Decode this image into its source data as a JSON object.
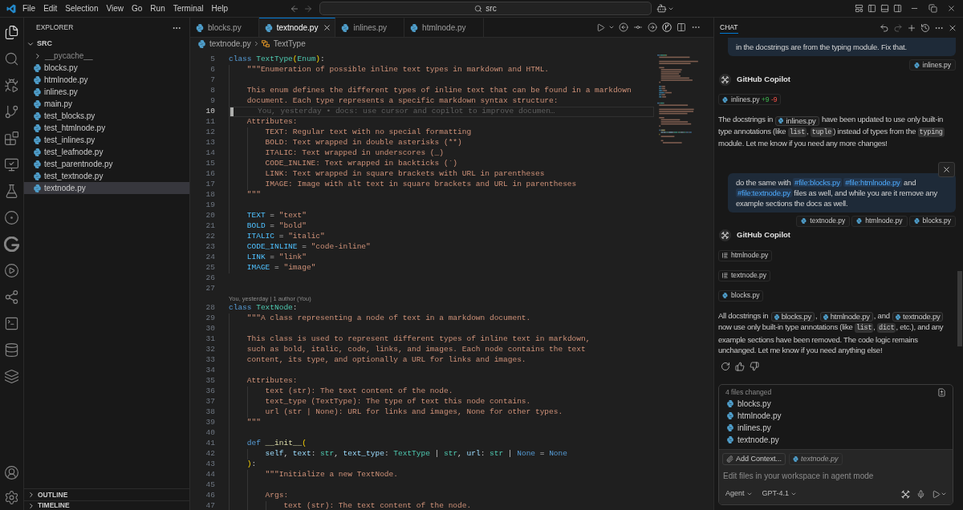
{
  "title_bar": {
    "menus": [
      "File",
      "Edit",
      "Selection",
      "View",
      "Go",
      "Run",
      "Terminal",
      "Help"
    ],
    "search": "src"
  },
  "activity_bar": [
    {
      "selected": true
    },
    {
      "selected": false
    },
    {
      "selected": false
    },
    {
      "selected": false
    },
    {
      "selected": false
    },
    {
      "selected": false
    },
    {
      "selected": false
    },
    {
      "selected": false
    },
    {
      "selected": false
    },
    {
      "selected": false
    },
    {
      "selected": false
    },
    {
      "selected": false
    },
    {
      "selected": false
    },
    {
      "selected": false
    }
  ],
  "sidebar": {
    "title": "EXPLORER",
    "folder": {
      "label": "SRC",
      "expanded": true,
      "items": [
        {
          "label": "__pycache__",
          "kind": "folder",
          "expanded": false,
          "ignored": true,
          "selected": false
        },
        {
          "label": "blocks.py",
          "kind": "file",
          "ignored": false,
          "selected": false
        },
        {
          "label": "htmlnode.py",
          "kind": "file",
          "ignored": false,
          "selected": false
        },
        {
          "label": "inlines.py",
          "kind": "file",
          "ignored": false,
          "selected": false
        },
        {
          "label": "main.py",
          "kind": "file",
          "ignored": false,
          "selected": false
        },
        {
          "label": "test_blocks.py",
          "kind": "file",
          "ignored": false,
          "selected": false
        },
        {
          "label": "test_htmlnode.py",
          "kind": "file",
          "ignored": false,
          "selected": false
        },
        {
          "label": "test_inlines.py",
          "kind": "file",
          "ignored": false,
          "selected": false
        },
        {
          "label": "test_leafnode.py",
          "kind": "file",
          "ignored": false,
          "selected": false
        },
        {
          "label": "test_parentnode.py",
          "kind": "file",
          "ignored": false,
          "selected": false
        },
        {
          "label": "test_textnode.py",
          "kind": "file",
          "ignored": false,
          "selected": false
        },
        {
          "label": "textnode.py",
          "kind": "file",
          "ignored": false,
          "selected": true
        }
      ]
    },
    "sections": [
      {
        "label": "OUTLINE",
        "expanded": false
      },
      {
        "label": "TIMELINE",
        "expanded": false
      }
    ]
  },
  "editor": {
    "tabs": [
      {
        "label": "blocks.py",
        "selected": false
      },
      {
        "label": "textnode.py",
        "selected": true
      },
      {
        "label": "inlines.py",
        "selected": false
      },
      {
        "label": "htmlnode.py",
        "selected": false
      }
    ],
    "breadcrumb": [
      {
        "kind": "file",
        "label": "textnode.py"
      },
      {
        "kind": "class",
        "label": "TextType"
      }
    ],
    "lines": [
      {
        "number": "5",
        "active": false,
        "tokens": [
          {
            "kind": "keyword",
            "text": "class"
          },
          {
            "kind": "type",
            "text": " TextType"
          },
          {
            "kind": "bracket",
            "text": "("
          },
          {
            "kind": "type",
            "text": "Enum"
          },
          {
            "kind": "bracket",
            "text": ")"
          },
          {
            "kind": "plain",
            "text": ":"
          }
        ]
      },
      {
        "number": "6",
        "active": false,
        "tokens": [
          {
            "kind": "string",
            "text": "    \"\"\"Enumeration of possible inline text types in markdown and HTML."
          }
        ]
      },
      {
        "number": "7",
        "active": false
      },
      {
        "number": "8",
        "active": false,
        "tokens": [
          {
            "kind": "string",
            "text": "    This enum defines the different types of inline text that can be found in a markdown"
          }
        ]
      },
      {
        "number": "9",
        "active": false,
        "tokens": [
          {
            "kind": "string",
            "text": "    document. Each type represents a specific markdown syntax structure:"
          }
        ]
      },
      {
        "number": "10",
        "active": true,
        "blame": "You, yesterday • docs: use cursor and copilot to improve documen…"
      },
      {
        "number": "11",
        "active": false,
        "tokens": [
          {
            "kind": "string",
            "text": "    Attributes:"
          }
        ]
      },
      {
        "number": "12",
        "active": false,
        "tokens": [
          {
            "kind": "string",
            "text": "        TEXT: Regular text with no special formatting"
          }
        ]
      },
      {
        "number": "13",
        "active": false,
        "tokens": [
          {
            "kind": "string",
            "text": "        BOLD: Text wrapped in double asterisks (**)"
          }
        ]
      },
      {
        "number": "14",
        "active": false,
        "tokens": [
          {
            "kind": "string",
            "text": "        ITALIC: Text wrapped in underscores (_)"
          }
        ]
      },
      {
        "number": "15",
        "active": false,
        "tokens": [
          {
            "kind": "string",
            "text": "        CODE_INLINE: Text wrapped in backticks (`)"
          }
        ]
      },
      {
        "number": "16",
        "active": false,
        "tokens": [
          {
            "kind": "string",
            "text": "        LINK: Text wrapped in square brackets with URL in parentheses"
          }
        ]
      },
      {
        "number": "17",
        "active": false,
        "tokens": [
          {
            "kind": "string",
            "text": "        IMAGE: Image with alt text in square brackets and URL in parentheses"
          }
        ]
      },
      {
        "number": "18",
        "active": false,
        "tokens": [
          {
            "kind": "string",
            "text": "    \"\"\""
          }
        ]
      },
      {
        "number": "19",
        "active": false
      },
      {
        "number": "20",
        "active": false,
        "tokens": [
          {
            "kind": "constant",
            "text": "    TEXT"
          },
          {
            "kind": "plain",
            "text": " = "
          },
          {
            "kind": "string",
            "text": "\"text\""
          }
        ]
      },
      {
        "number": "21",
        "active": false,
        "tokens": [
          {
            "kind": "constant",
            "text": "    BOLD"
          },
          {
            "kind": "plain",
            "text": " = "
          },
          {
            "kind": "string",
            "text": "\"bold\""
          }
        ]
      },
      {
        "number": "22",
        "active": false,
        "tokens": [
          {
            "kind": "constant",
            "text": "    ITALIC"
          },
          {
            "kind": "plain",
            "text": " = "
          },
          {
            "kind": "string",
            "text": "\"italic\""
          }
        ]
      },
      {
        "number": "23",
        "active": false,
        "tokens": [
          {
            "kind": "constant",
            "text": "    CODE_INLINE"
          },
          {
            "kind": "plain",
            "text": " = "
          },
          {
            "kind": "string",
            "text": "\"code-inline\""
          }
        ]
      },
      {
        "number": "24",
        "active": false,
        "tokens": [
          {
            "kind": "constant",
            "text": "    LINK"
          },
          {
            "kind": "plain",
            "text": " = "
          },
          {
            "kind": "string",
            "text": "\"link\""
          }
        ]
      },
      {
        "number": "25",
        "active": false,
        "tokens": [
          {
            "kind": "constant",
            "text": "    IMAGE"
          },
          {
            "kind": "plain",
            "text": " = "
          },
          {
            "kind": "string",
            "text": "\"image\""
          }
        ]
      },
      {
        "number": "26",
        "active": false
      },
      {
        "number": "27",
        "active": false
      },
      {
        "number": "28",
        "active": false,
        "codelens": "You, yesterday | 1 author (You)",
        "tokens": [
          {
            "kind": "keyword",
            "text": "class"
          },
          {
            "kind": "type",
            "text": " TextNode"
          },
          {
            "kind": "plain",
            "text": ":"
          }
        ]
      },
      {
        "number": "29",
        "active": false,
        "tokens": [
          {
            "kind": "string",
            "text": "    \"\"\"A class representing a node of text in a markdown document."
          }
        ]
      },
      {
        "number": "30",
        "active": false
      },
      {
        "number": "31",
        "active": false,
        "tokens": [
          {
            "kind": "string",
            "text": "    This class is used to represent different types of inline text in markdown,"
          }
        ]
      },
      {
        "number": "32",
        "active": false,
        "tokens": [
          {
            "kind": "string",
            "text": "    such as bold, italic, code, links, and images. Each node contains the text"
          }
        ]
      },
      {
        "number": "33",
        "active": false,
        "tokens": [
          {
            "kind": "string",
            "text": "    content, its type, and optionally a URL for links and images."
          }
        ]
      },
      {
        "number": "34",
        "active": false
      },
      {
        "number": "35",
        "active": false,
        "tokens": [
          {
            "kind": "string",
            "text": "    Attributes:"
          }
        ]
      },
      {
        "number": "36",
        "active": false,
        "tokens": [
          {
            "kind": "string",
            "text": "        text (str): The text content of the node."
          }
        ]
      },
      {
        "number": "37",
        "active": false,
        "tokens": [
          {
            "kind": "string",
            "text": "        text_type (TextType): The type of text this node contains."
          }
        ]
      },
      {
        "number": "38",
        "active": false,
        "tokens": [
          {
            "kind": "string",
            "text": "        url (str | None): URL for links and images, None for other types."
          }
        ]
      },
      {
        "number": "39",
        "active": false,
        "tokens": [
          {
            "kind": "string",
            "text": "    \"\"\""
          }
        ]
      },
      {
        "number": "40",
        "active": false
      },
      {
        "number": "41",
        "active": false,
        "tokens": [
          {
            "kind": "keyword",
            "text": "    def"
          },
          {
            "kind": "function",
            "text": " __init__"
          },
          {
            "kind": "bracket",
            "text": "("
          }
        ]
      },
      {
        "number": "42",
        "active": false,
        "tokens": [
          {
            "kind": "param",
            "text": "        self"
          },
          {
            "kind": "plain",
            "text": ", "
          },
          {
            "kind": "param",
            "text": "text"
          },
          {
            "kind": "plain",
            "text": ": "
          },
          {
            "kind": "type",
            "text": "str"
          },
          {
            "kind": "plain",
            "text": ", "
          },
          {
            "kind": "param",
            "text": "text_type"
          },
          {
            "kind": "plain",
            "text": ": "
          },
          {
            "kind": "type",
            "text": "TextType"
          },
          {
            "kind": "plain",
            "text": " | "
          },
          {
            "kind": "type",
            "text": "str"
          },
          {
            "kind": "plain",
            "text": ", "
          },
          {
            "kind": "param",
            "text": "url"
          },
          {
            "kind": "plain",
            "text": ": "
          },
          {
            "kind": "type",
            "text": "str"
          },
          {
            "kind": "plain",
            "text": " | "
          },
          {
            "kind": "keyword",
            "text": "None"
          },
          {
            "kind": "plain",
            "text": " = "
          },
          {
            "kind": "keyword",
            "text": "None"
          }
        ]
      },
      {
        "number": "43",
        "active": false,
        "tokens": [
          {
            "kind": "bracket",
            "text": "    )"
          },
          {
            "kind": "plain",
            "text": ":"
          }
        ]
      },
      {
        "number": "44",
        "active": false,
        "tokens": [
          {
            "kind": "string",
            "text": "        \"\"\"Initialize a new TextNode."
          }
        ]
      },
      {
        "number": "45",
        "active": false
      },
      {
        "number": "46",
        "active": false,
        "tokens": [
          {
            "kind": "string",
            "text": "        Args:"
          }
        ]
      },
      {
        "number": "47",
        "active": false,
        "tokens": [
          {
            "kind": "string",
            "text": "            text (str): The text content of the node."
          }
        ]
      }
    ]
  },
  "chat": {
    "title": "CHAT",
    "messages": [
      {
        "kind": "request",
        "hovered": false,
        "segments": [
          {
            "kind": "text",
            "text": "in the docstrings are from the typing module. Fix that."
          }
        ],
        "attachments": [
          "inlines.py"
        ]
      },
      {
        "kind": "response",
        "author": "GitHub Copilot",
        "show_actions": false,
        "edits": [
          {
            "kind": "python",
            "file": "inlines.py",
            "added": "+9",
            "removed": "-9"
          }
        ],
        "segments": [
          {
            "kind": "text",
            "text": "The docstrings in "
          },
          {
            "kind": "file",
            "text": "inlines.py"
          },
          {
            "kind": "text",
            "text": " have been updated to use only built-in type annotations (like "
          },
          {
            "kind": "code",
            "text": "list"
          },
          {
            "kind": "text",
            "text": ", "
          },
          {
            "kind": "code",
            "text": "tuple"
          },
          {
            "kind": "text",
            "text": ") instead of types from the "
          },
          {
            "kind": "code",
            "text": "typing"
          },
          {
            "kind": "text",
            "text": " module. Let me know if you need any more changes!"
          }
        ]
      },
      {
        "kind": "request",
        "hovered": true,
        "segments": [
          {
            "kind": "text",
            "text": "do the same with "
          },
          {
            "kind": "reference",
            "text": "#file:blocks.py"
          },
          {
            "kind": "reference",
            "text": "#file:htmlnode.py"
          },
          {
            "kind": "text",
            "text": " and "
          },
          {
            "kind": "reference",
            "text": "#file:textnode.py"
          },
          {
            "kind": "text",
            "text": " files as well, and while you are it remove any example sections the docs as well."
          }
        ],
        "attachments": [
          "textnode.py",
          "htmlnode.py",
          "blocks.py"
        ]
      },
      {
        "kind": "response",
        "author": "GitHub Copilot",
        "show_actions": true,
        "edits": [
          {
            "kind": "text",
            "file": "htmlnode.py"
          },
          {
            "kind": "text",
            "file": "textnode.py"
          },
          {
            "kind": "python",
            "file": "blocks.py"
          }
        ],
        "segments": [
          {
            "kind": "text",
            "text": "All docstrings in "
          },
          {
            "kind": "file",
            "text": "blocks.py"
          },
          {
            "kind": "text",
            "text": ", "
          },
          {
            "kind": "file",
            "text": "htmlnode.py"
          },
          {
            "kind": "text",
            "text": ", and "
          },
          {
            "kind": "file",
            "text": "textnode.py"
          },
          {
            "kind": "text",
            "text": " now use only built-in type annotations (like "
          },
          {
            "kind": "code",
            "text": "list"
          },
          {
            "kind": "text",
            "text": ", "
          },
          {
            "kind": "code",
            "text": "dict"
          },
          {
            "kind": "text",
            "text": ", etc.), and any example sections have been removed. The code logic remains unchanged. Let me know if you need anything else!"
          }
        ]
      }
    ],
    "input": {
      "changes": {
        "summary": "4 files changed",
        "files": [
          "blocks.py",
          "htmlnode.py",
          "inlines.py",
          "textnode.py"
        ]
      },
      "add_context": "Add Context...",
      "context_file": "textnode.py",
      "placeholder": "Edit files in your workspace in agent mode",
      "mode": "Agent",
      "model": "GPT-4.1"
    }
  }
}
